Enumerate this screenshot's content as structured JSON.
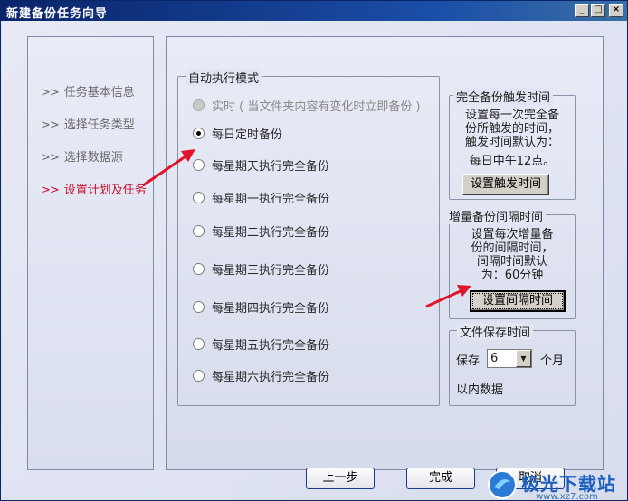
{
  "window": {
    "title": "新建备份任务向导",
    "min_label": "_",
    "max_label": "□",
    "close_label": "×"
  },
  "steps": [
    {
      "arrows": ">>",
      "label": "任务基本信息",
      "active": false
    },
    {
      "arrows": ">>",
      "label": "选择任务类型",
      "active": false
    },
    {
      "arrows": ">>",
      "label": "选择数据源",
      "active": false
    },
    {
      "arrows": ">>",
      "label": "设置计划及任务",
      "active": true
    }
  ],
  "auto_mode": {
    "title": "自动执行模式",
    "options": [
      {
        "label": "实时 ( 当文件夹内容有变化时立即备份 )",
        "checked": false,
        "disabled": true
      },
      {
        "label": "每日定时备份",
        "checked": true,
        "disabled": false
      },
      {
        "label": "每星期天执行完全备份",
        "checked": false,
        "disabled": false
      },
      {
        "label": "每星期一执行完全备份",
        "checked": false,
        "disabled": false
      },
      {
        "label": "每星期二执行完全备份",
        "checked": false,
        "disabled": false
      },
      {
        "label": "每星期三执行完全备份",
        "checked": false,
        "disabled": false
      },
      {
        "label": "每星期四执行完全备份",
        "checked": false,
        "disabled": false
      },
      {
        "label": "每星期五执行完全备份",
        "checked": false,
        "disabled": false
      },
      {
        "label": "每星期六执行完全备份",
        "checked": false,
        "disabled": false
      }
    ]
  },
  "full_backup": {
    "title": "完全备份触发时间",
    "desc_line1": "设置每一次完全备",
    "desc_line2": "份所触发的时间，",
    "desc_line3": "触发时间默认为：",
    "desc_line4": "每日中午12点。",
    "button": "设置触发时间"
  },
  "incremental": {
    "title": "增量备份间隔时间",
    "desc_line1": "设置每次增量备",
    "desc_line2": "份的间隔时间，",
    "desc_line3": "间隔时间默认",
    "desc_line4": "为：60分钟",
    "button": "设置间隔时间"
  },
  "retention": {
    "title": "文件保存时间",
    "prefix": "保存",
    "value": "6",
    "unit": "个月",
    "suffix": "以内数据"
  },
  "nav": {
    "prev": "上一步",
    "finish": "完成",
    "cancel": "取消"
  },
  "watermark": {
    "text": "极光下载站",
    "url": "www.xz7.com"
  },
  "colors": {
    "title_bar": "#0a246a",
    "active_step": "#c8102e",
    "arrow": "#e0142a"
  }
}
